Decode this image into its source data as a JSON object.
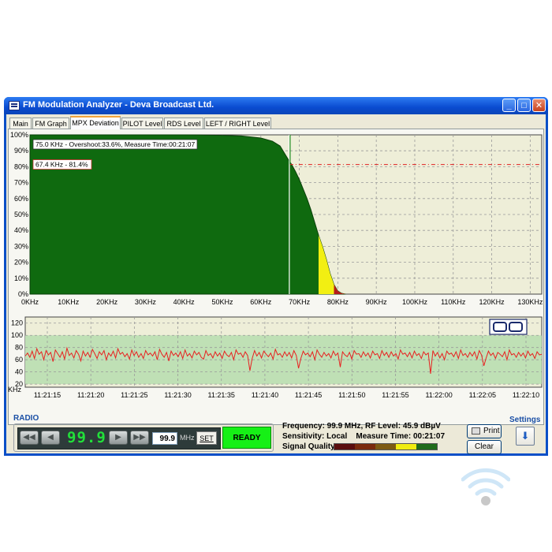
{
  "window": {
    "title": "FM Modulation Analyzer - Deva Broadcast Ltd.",
    "minimize_glyph": "_",
    "maximize_glyph": "□",
    "close_glyph": "✕"
  },
  "tabs": [
    {
      "label": "Main",
      "active": false
    },
    {
      "label": "FM Graph",
      "active": false
    },
    {
      "label": "MPX Deviation",
      "active": true
    },
    {
      "label": "PILOT Level",
      "active": false
    },
    {
      "label": "RDS Level",
      "active": false
    },
    {
      "label": "LEFT / RIGHT Level",
      "active": false
    }
  ],
  "radio": {
    "caption": "RADIO",
    "frequency_display": "99.9",
    "frequency_input": "99.9",
    "unit": "MHz",
    "set_label": "SET",
    "ready_label": "READY"
  },
  "status": {
    "frequency_line": "Frequency: 99.9 MHz, RF Level: 45.9 dBµV",
    "sensitivity_line": "Sensitivity: Local    Measure Time: 00:21:07",
    "quality_label": "Signal Quality:",
    "quality_colors": [
      "#5a0d0d",
      "#7a2a0c",
      "#7d5a12",
      "#f0ec10",
      "#1f6b1a"
    ]
  },
  "buttons": {
    "print_label": "Print",
    "clear_label": "Clear",
    "settings_caption": "Settings"
  },
  "colors": {
    "accent_green": "#0f6a0f",
    "trace_red": "#e82020",
    "band_green": "#bfe0b5"
  },
  "chart_data": [
    {
      "type": "area",
      "x_unit": "KHz",
      "x_ticks": [
        "0KHz",
        "10KHz",
        "20KHz",
        "30KHz",
        "40KHz",
        "50KHz",
        "60KHz",
        "70KHz",
        "80KHz",
        "90KHz",
        "100KHz",
        "110KHz",
        "120KHz",
        "130KHz"
      ],
      "y_ticks": [
        "0%",
        "10%",
        "20%",
        "30%",
        "40%",
        "50%",
        "60%",
        "70%",
        "80%",
        "90%",
        "100%"
      ],
      "xlim": [
        0,
        133
      ],
      "ylim": [
        0,
        100
      ],
      "grid": true,
      "x": [
        0,
        5,
        10,
        15,
        20,
        25,
        30,
        35,
        40,
        45,
        50,
        55,
        60,
        63,
        65,
        67,
        68,
        69,
        70,
        71,
        72,
        73,
        74,
        75,
        76,
        77,
        78,
        79,
        80,
        81,
        82
      ],
      "y": [
        100,
        100,
        100,
        100,
        100,
        100,
        100,
        100,
        100,
        99.9,
        99.7,
        99.3,
        98,
        96,
        93,
        85,
        81.4,
        77,
        72,
        66,
        60,
        53,
        45,
        37,
        30,
        22,
        13,
        6,
        2,
        0.5,
        0
      ],
      "overshoot_threshold": 75.0,
      "measure_line_x": 67.4,
      "reference_line_y": 81.4,
      "annotations": [
        "75.0 KHz - Overshoot:33.6%, Measure Time:00:21:07",
        "67.4 KHz - 81.4%"
      ]
    },
    {
      "type": "line",
      "y_unit": "KHz",
      "y_ticks": [
        "20",
        "40",
        "60",
        "80",
        "100",
        "120"
      ],
      "ylim": [
        15,
        130
      ],
      "band": [
        20,
        100
      ],
      "x_ticks": [
        "11:21:15",
        "11:21:20",
        "11:21:25",
        "11:21:30",
        "11:21:35",
        "11:21:40",
        "11:21:45",
        "11:21:50",
        "11:21:55",
        "11:22:00",
        "11:22:05",
        "11:22:10"
      ],
      "series": [
        {
          "values": [
            66,
            71,
            64,
            74,
            62,
            78,
            69,
            73,
            60,
            75,
            68,
            72,
            57,
            76,
            70,
            64,
            73,
            61,
            79,
            67,
            71,
            63,
            75,
            69,
            58,
            74,
            66,
            72,
            64,
            77,
            70,
            62,
            73,
            68,
            75,
            60,
            71,
            66,
            74,
            63,
            78,
            69,
            72,
            65,
            70,
            61,
            76,
            67,
            73,
            64,
            70,
            62,
            75,
            68,
            71,
            66,
            73,
            60,
            77,
            69,
            64,
            72,
            58,
            74,
            67,
            71,
            65,
            73,
            62,
            76,
            66,
            70,
            63,
            74,
            68,
            72,
            64,
            61,
            75,
            67,
            70,
            63,
            73,
            66,
            71,
            62,
            74,
            68,
            65,
            72,
            60,
            76,
            69,
            71,
            64,
            73,
            67,
            70,
            62,
            75,
            66,
            72,
            63,
            74,
            69,
            65,
            71,
            61,
            77,
            68,
            70,
            64,
            73,
            66,
            72,
            63,
            75,
            67,
            70,
            62,
            74,
            68,
            71,
            65,
            73,
            60,
            76,
            69,
            64,
            72,
            66,
            70,
            63,
            74,
            67,
            71,
            62,
            73,
            68,
            65,
            72,
            61,
            75,
            69,
            70,
            64,
            73,
            66,
            71,
            63,
            74,
            68,
            70,
            62,
            75,
            67,
            72,
            64,
            73,
            66,
            70,
            61,
            76,
            69,
            71,
            65,
            72,
            63,
            74,
            67,
            70,
            62,
            73,
            68,
            71,
            64,
            75,
            66,
            72,
            63,
            70,
            60,
            74,
            69,
            71,
            65,
            73,
            62,
            76,
            67,
            70,
            64,
            72,
            66,
            73,
            61,
            75,
            68,
            70,
            63,
            74,
            67,
            71,
            62,
            72,
            69,
            65,
            73,
            60,
            76,
            68,
            70,
            64,
            72,
            66,
            71,
            63,
            74,
            67,
            70,
            62,
            73,
            68,
            69
          ]
        }
      ]
    }
  ]
}
